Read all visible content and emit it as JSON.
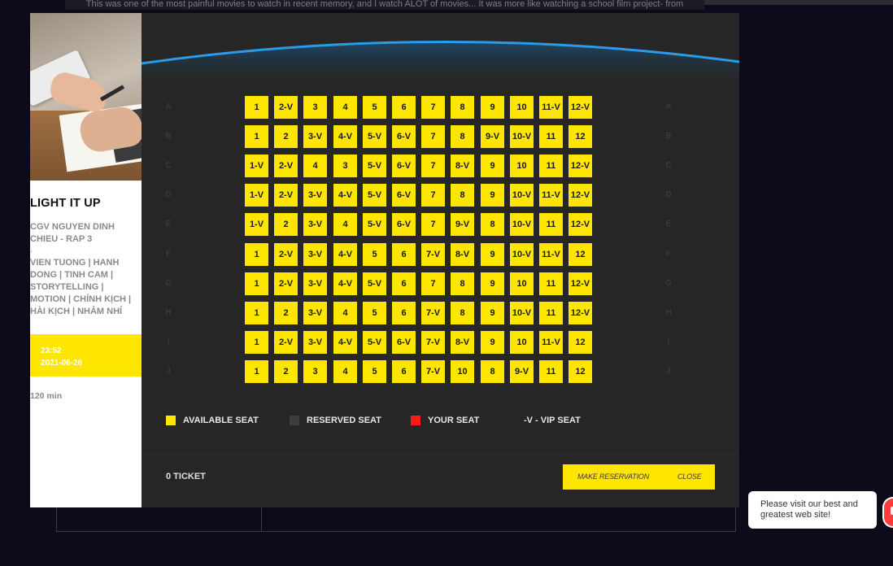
{
  "background": {
    "review_text": "This was one of the most painful movies to watch in recent memory, and I watch ALOT of movies... It was more like watching a school film project- from"
  },
  "movie": {
    "title": "LIGHT IT UP",
    "cinema": "CGV NGUYEN DINH CHIEU - RAP 3",
    "separator": ".",
    "genres": "VIEN TUONG | HANH DONG | TINH CAM | STORYTELLING | MOTION | CHÍNH KỊCH | HÀI KỊCH | NHẢM NHÍ",
    "time": "23:52",
    "date": "2021-06-26",
    "duration": "120 min"
  },
  "seat_map": {
    "rows": [
      "A",
      "B",
      "C",
      "D",
      "E",
      "F",
      "G",
      "H",
      "I",
      "J"
    ],
    "seats": [
      [
        "1",
        "2-V",
        "3",
        "4",
        "5",
        "6",
        "7",
        "8",
        "9",
        "10",
        "11-V",
        "12-V"
      ],
      [
        "1",
        "2",
        "3-V",
        "4-V",
        "5-V",
        "6-V",
        "7",
        "8",
        "9-V",
        "10-V",
        "11",
        "12"
      ],
      [
        "1-V",
        "2-V",
        "4",
        "3",
        "5-V",
        "6-V",
        "7",
        "8-V",
        "9",
        "10",
        "11",
        "12-V"
      ],
      [
        "1-V",
        "2-V",
        "3-V",
        "4-V",
        "5-V",
        "6-V",
        "7",
        "8",
        "9",
        "10-V",
        "11-V",
        "12-V"
      ],
      [
        "1-V",
        "2",
        "3-V",
        "4",
        "5-V",
        "6-V",
        "7",
        "9-V",
        "8",
        "10-V",
        "11",
        "12-V"
      ],
      [
        "1",
        "2-V",
        "3-V",
        "4-V",
        "5",
        "6",
        "7-V",
        "8-V",
        "9",
        "10-V",
        "11-V",
        "12"
      ],
      [
        "1",
        "2-V",
        "3-V",
        "4-V",
        "5-V",
        "6",
        "7",
        "8",
        "9",
        "10",
        "11",
        "12-V"
      ],
      [
        "1",
        "2",
        "3-V",
        "4",
        "5",
        "6",
        "7-V",
        "8",
        "9",
        "10-V",
        "11",
        "12-V"
      ],
      [
        "1",
        "2-V",
        "3-V",
        "4-V",
        "5-V",
        "6-V",
        "7-V",
        "8-V",
        "9",
        "10",
        "11-V",
        "12"
      ],
      [
        "1",
        "2",
        "3",
        "4",
        "5",
        "6",
        "7-V",
        "10",
        "8",
        "9-V",
        "11",
        "12"
      ]
    ]
  },
  "legend": {
    "available": "AVAILABLE SEAT",
    "reserved": "RESERVED SEAT",
    "yours": "YOUR SEAT",
    "vip": "-V - VIP SEAT"
  },
  "footer": {
    "ticket_count": "0 TICKET",
    "reserve_button": "MAKE RESERVATION",
    "close_button": "CLOSE"
  },
  "chat": {
    "message": "Please visit our best and greatest web site!"
  },
  "colors": {
    "accent_yellow": "#ffe600",
    "reserved_gray": "#3d3d3d",
    "your_seat_red": "#ff1a1a",
    "screen_blue": "#2a9be8"
  }
}
